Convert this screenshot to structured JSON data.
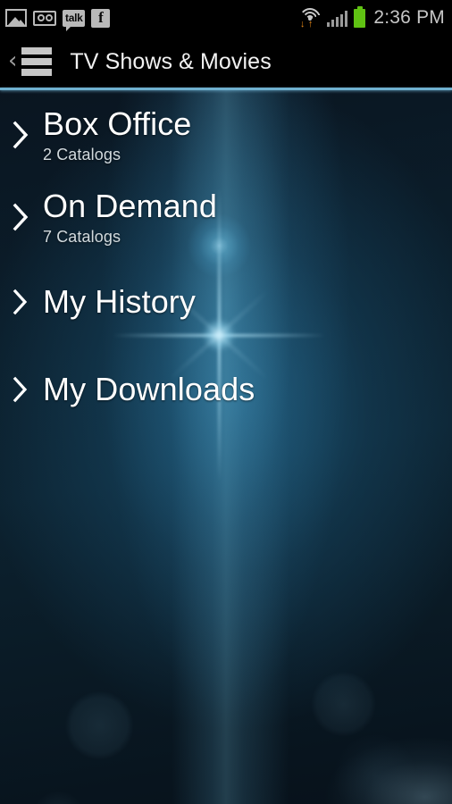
{
  "status_bar": {
    "time": "2:36 PM",
    "left_icons": [
      {
        "name": "photo-icon",
        "label": ""
      },
      {
        "name": "voicemail-icon",
        "label": ""
      },
      {
        "name": "talk-icon",
        "label": "talk"
      },
      {
        "name": "facebook-icon",
        "label": "f"
      }
    ],
    "right_icons": [
      {
        "name": "wifi-icon",
        "down_arrow": "↓",
        "up_arrow": "↑"
      },
      {
        "name": "cellular-signal-icon"
      },
      {
        "name": "battery-icon"
      }
    ],
    "colors": {
      "background": "#000000",
      "icon_gray": "#b9b9b9",
      "time_gray": "#c6c6c6",
      "data_arrow_orange": "#e98a18",
      "battery_green": "#60c213"
    }
  },
  "action_bar": {
    "back_glyph": "‹",
    "title": "TV Shows & Movies",
    "divider_color": "#6fb0cf"
  },
  "list": {
    "chevron_glyph": "›",
    "items": [
      {
        "title": "Box Office",
        "subtitle": "2 Catalogs",
        "has_subtitle": true
      },
      {
        "title": "On Demand",
        "subtitle": "7 Catalogs",
        "has_subtitle": true
      },
      {
        "title": "My History",
        "subtitle": "",
        "has_subtitle": false
      },
      {
        "title": "My Downloads",
        "subtitle": "",
        "has_subtitle": false
      }
    ]
  },
  "background": {
    "base_color": "#0b1d2a",
    "glow_color": "#22688e",
    "flare_color": "#b9e8fa"
  }
}
